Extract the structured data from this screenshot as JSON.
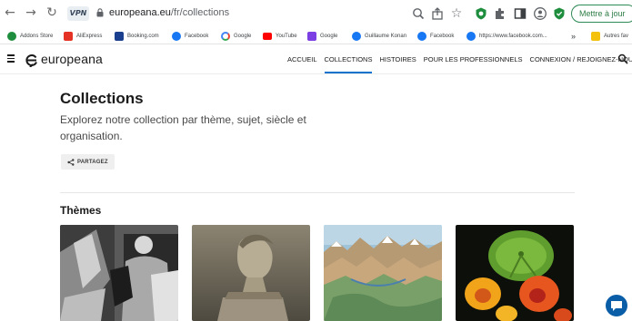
{
  "browser": {
    "url_domain": "europeana.eu",
    "url_path": "/fr/collections",
    "vpn_label": "VPN",
    "update_button": "Mettre à jour",
    "bookmarks": [
      {
        "label": "Addons Store",
        "color": "#1e8e3e"
      },
      {
        "label": "AliExpress",
        "color": "#e43225"
      },
      {
        "label": "Booking.com",
        "color": "#1a3f8f"
      },
      {
        "label": "Facebook",
        "color": "#1877f2"
      },
      {
        "label": "Google",
        "color": "#4a4a4a"
      },
      {
        "label": "YouTube",
        "color": "#ff0000"
      },
      {
        "label": "Google",
        "color": "#7b3fe4"
      },
      {
        "label": "Guillaume Konan",
        "color": "#1877f2"
      },
      {
        "label": "Facebook",
        "color": "#1877f2"
      },
      {
        "label": "https://www.facebook.com...",
        "color": "#1877f2"
      }
    ],
    "overflow_label": "»",
    "other_bookmarks": "Autres fav"
  },
  "site": {
    "logo": "europeana",
    "nav": [
      {
        "label": "ACCUEIL",
        "active": false
      },
      {
        "label": "COLLECTIONS",
        "active": true
      },
      {
        "label": "HISTOIRES",
        "active": false
      },
      {
        "label": "POUR LES PROFESSIONNELS",
        "active": false
      },
      {
        "label": "CONNEXION / REJOIGNEZ-NOUS",
        "active": false
      }
    ]
  },
  "page": {
    "title": "Collections",
    "description": "Explorez notre collection par thème, sujet, siècle et organisation.",
    "share_label": "PARTAGEZ",
    "themes_title": "Thèmes"
  },
  "colors": {
    "accent": "#0a72cc",
    "chat": "#0a5ea8"
  }
}
